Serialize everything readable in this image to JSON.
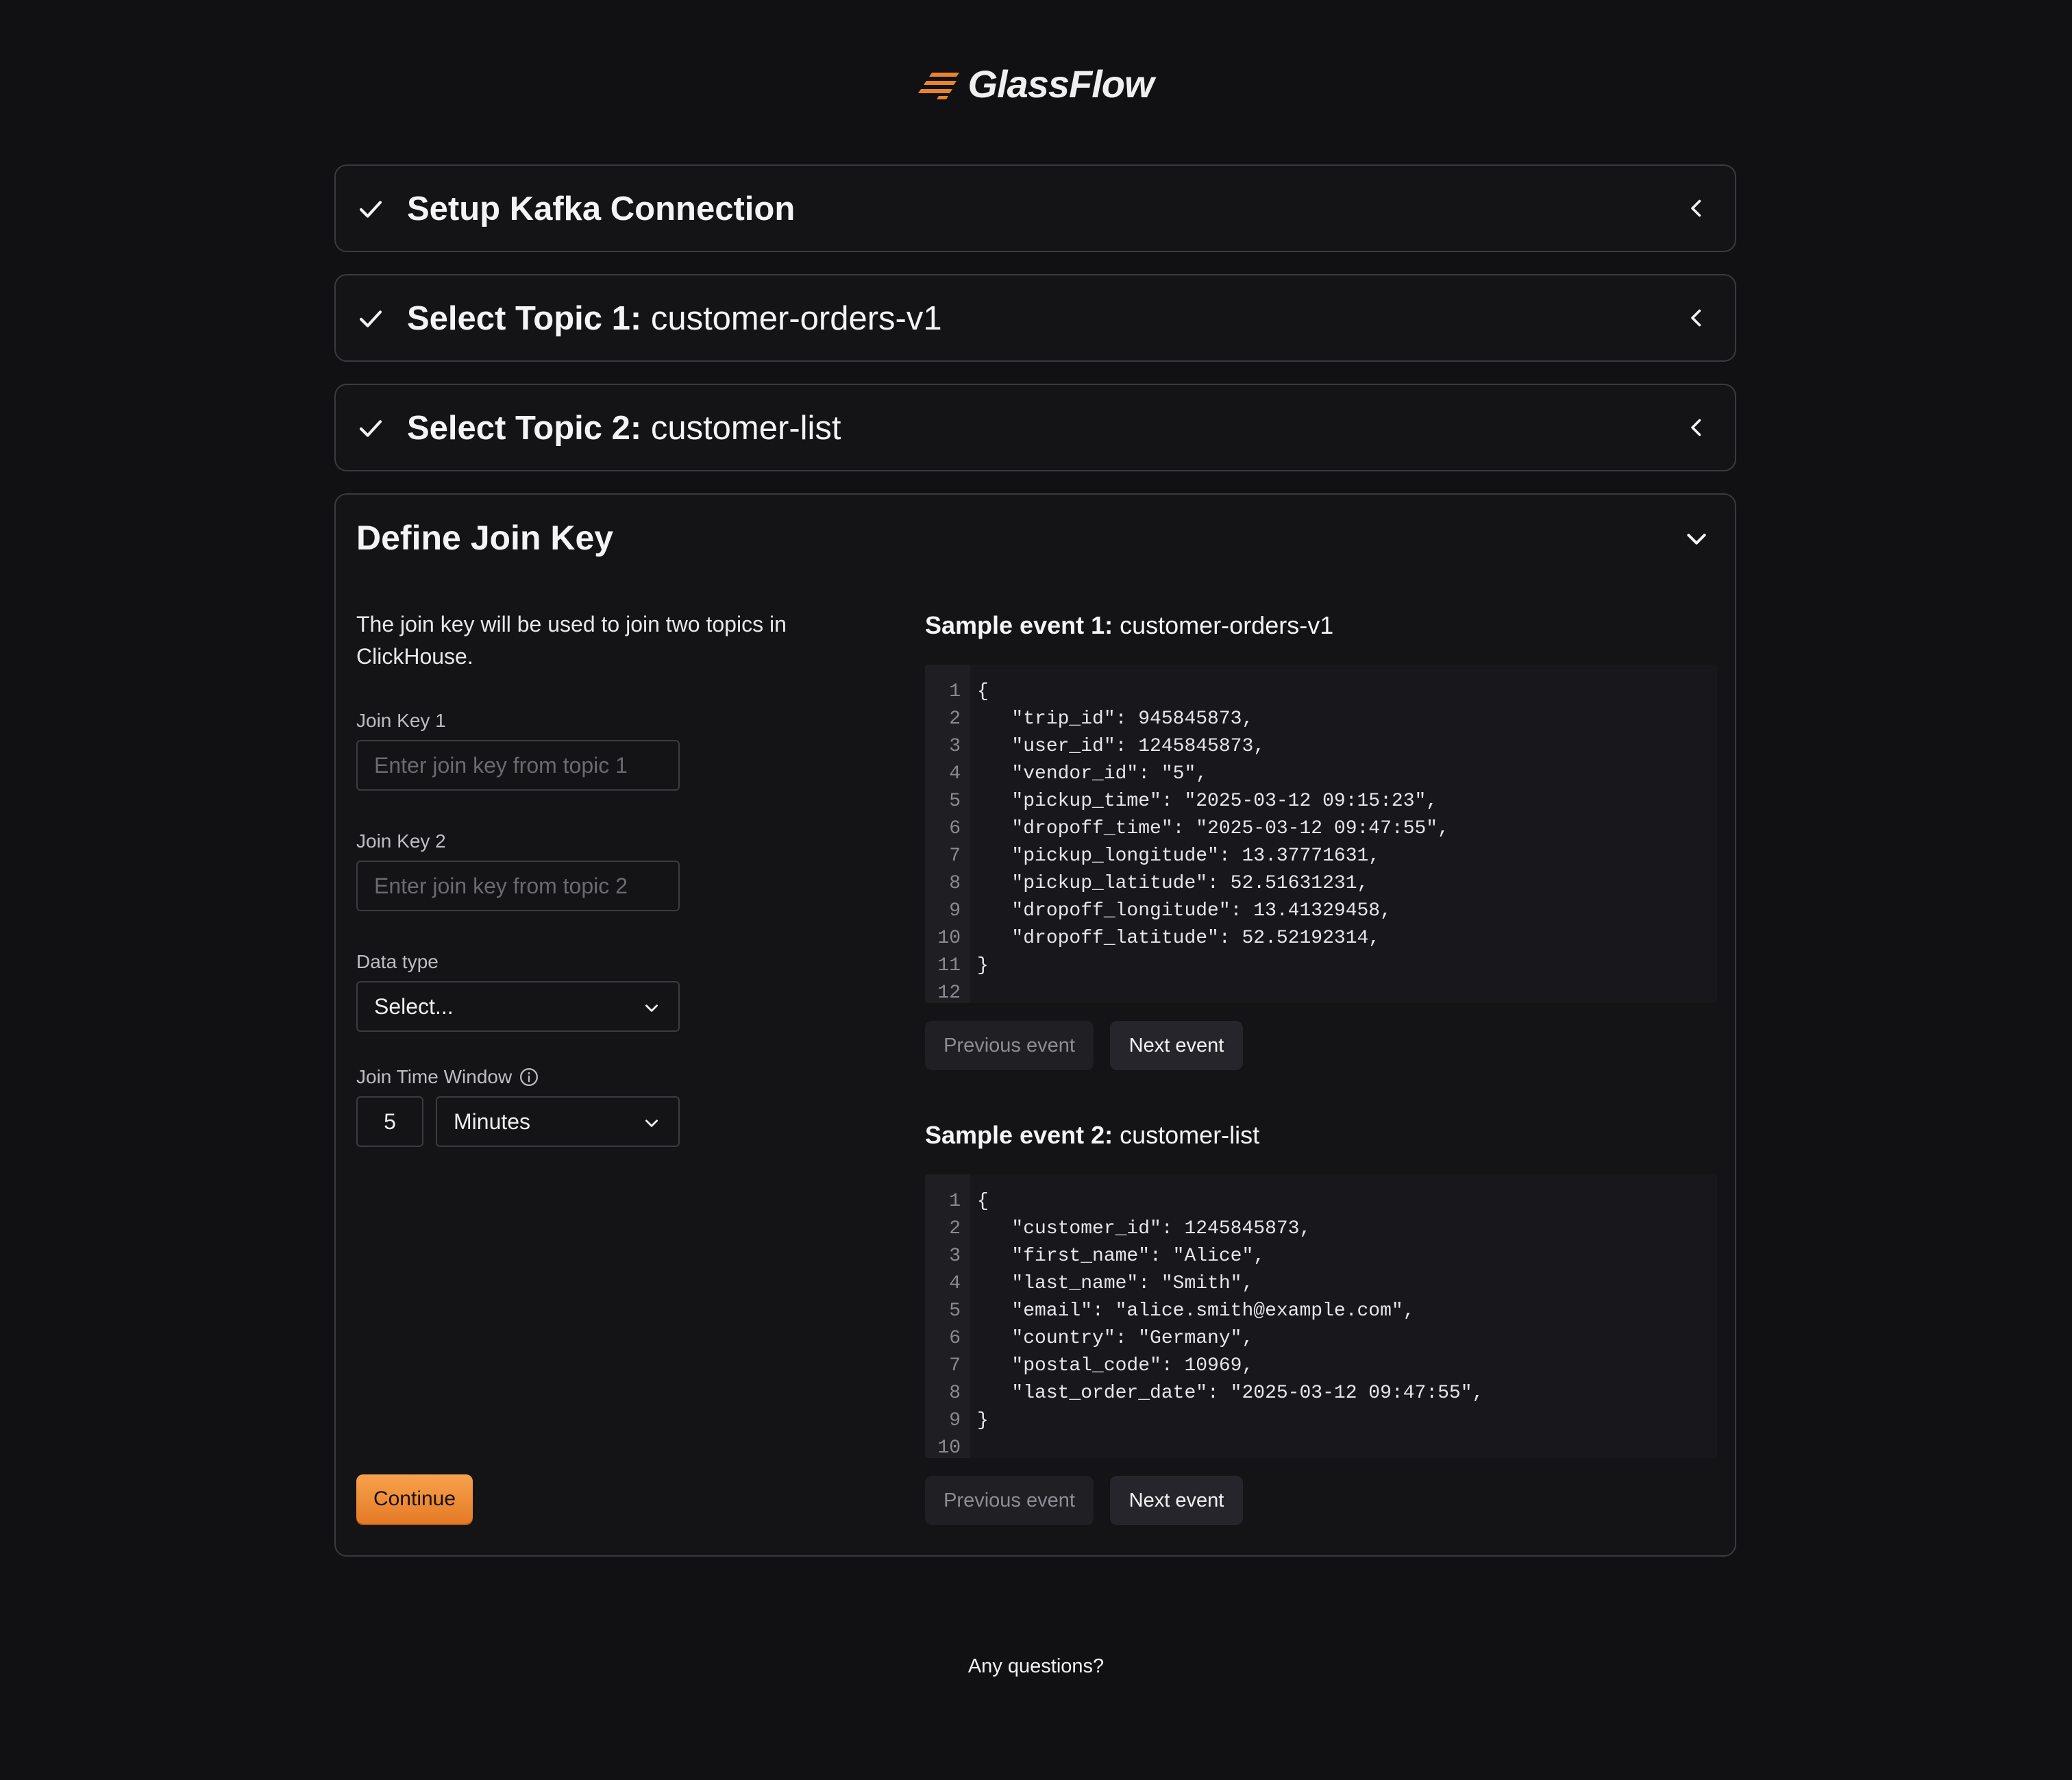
{
  "brand": {
    "name": "GlassFlow",
    "accent": "#e8832f"
  },
  "steps": [
    {
      "title": "Setup Kafka Connection",
      "value": ""
    },
    {
      "title": "Select Topic 1:",
      "value": "customer-orders-v1"
    },
    {
      "title": "Select Topic 2:",
      "value": "customer-list"
    }
  ],
  "join_key": {
    "title": "Define Join Key",
    "description": "The join key will be used to join two topics in ClickHouse.",
    "key1": {
      "label": "Join Key 1",
      "placeholder": "Enter join key from topic 1"
    },
    "key2": {
      "label": "Join Key 2",
      "placeholder": "Enter join key from topic 2"
    },
    "data_type": {
      "label": "Data type",
      "value": "Select..."
    },
    "time_window": {
      "label": "Join Time Window",
      "amount": "5",
      "unit": "Minutes"
    },
    "continue_label": "Continue"
  },
  "samples": [
    {
      "title": "Sample event 1:",
      "topic": "customer-orders-v1",
      "lines": [
        {
          "n": "1",
          "t": "{"
        },
        {
          "n": "2",
          "t": "   \"trip_id\": 945845873,"
        },
        {
          "n": "3",
          "t": "   \"user_id\": 1245845873,"
        },
        {
          "n": "4",
          "t": "   \"vendor_id\": \"5\","
        },
        {
          "n": "5",
          "t": "   \"pickup_time\": \"2025-03-12 09:15:23\","
        },
        {
          "n": "6",
          "t": "   \"dropoff_time\": \"2025-03-12 09:47:55\","
        },
        {
          "n": "7",
          "t": "   \"pickup_longitude\": 13.37771631,"
        },
        {
          "n": "8",
          "t": "   \"pickup_latitude\": 52.51631231,"
        },
        {
          "n": "9",
          "t": "   \"dropoff_longitude\": 13.41329458,"
        },
        {
          "n": "10",
          "t": "   \"dropoff_latitude\": 52.52192314,"
        },
        {
          "n": "11",
          "t": "}"
        },
        {
          "n": "12",
          "t": ""
        }
      ],
      "prev_label": "Previous event",
      "next_label": "Next event"
    },
    {
      "title": "Sample event 2:",
      "topic": "customer-list",
      "lines": [
        {
          "n": "1",
          "t": "{"
        },
        {
          "n": "2",
          "t": "   \"customer_id\": 1245845873,"
        },
        {
          "n": "3",
          "t": "   \"first_name\": \"Alice\","
        },
        {
          "n": "4",
          "t": "   \"last_name\": \"Smith\","
        },
        {
          "n": "5",
          "t": "   \"email\": \"alice.smith@example.com\","
        },
        {
          "n": "6",
          "t": "   \"country\": \"Germany\","
        },
        {
          "n": "7",
          "t": "   \"postal_code\": 10969,"
        },
        {
          "n": "8",
          "t": "   \"last_order_date\": \"2025-03-12 09:47:55\","
        },
        {
          "n": "9",
          "t": "}"
        },
        {
          "n": "10",
          "t": ""
        }
      ],
      "prev_label": "Previous event",
      "next_label": "Next event"
    }
  ],
  "footer": {
    "questions": "Any questions?"
  }
}
